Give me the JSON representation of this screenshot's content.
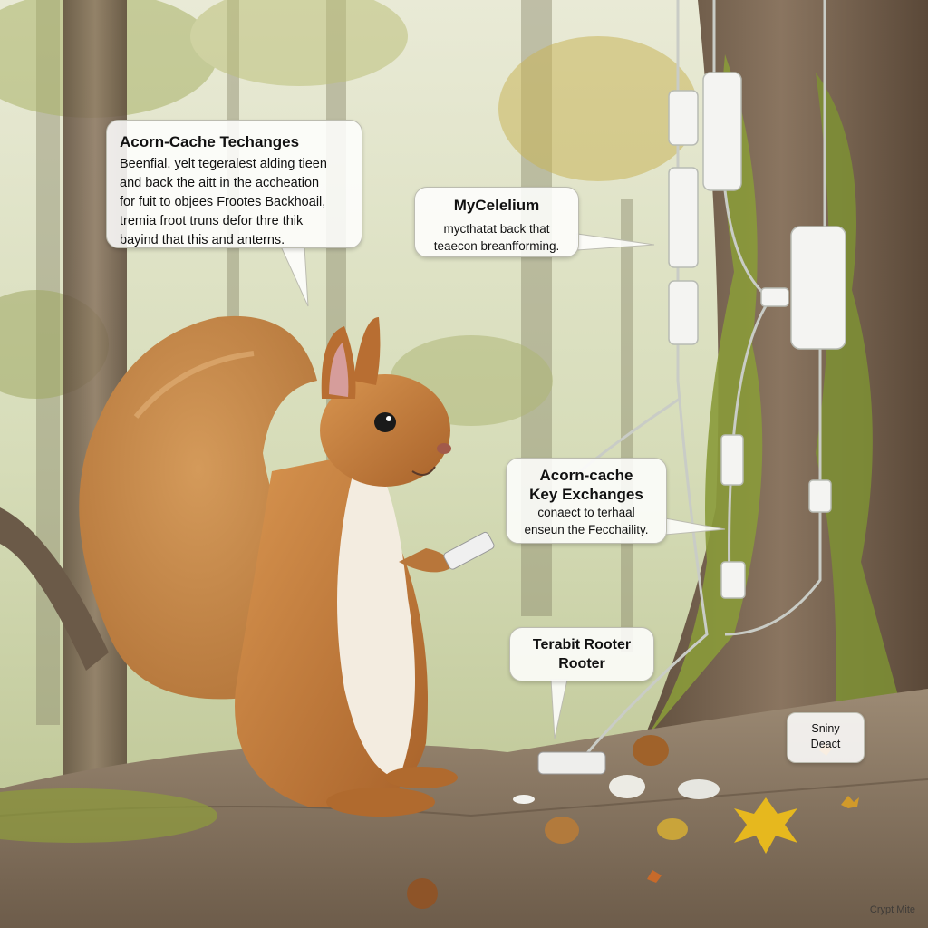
{
  "callouts": {
    "acorn_cache_techanges": {
      "title": "Acorn-Cache Techanges",
      "lines": [
        "Beenfial, yelt tegeralest alding tieen",
        "and back the aitt in the accheation",
        "for fuit to objees Frootes Backhoail,",
        "tremia froot truns defor thre thik",
        "bayind that this and anterns."
      ]
    },
    "mycelium": {
      "title": "MyCelelium",
      "lines": [
        "mycthatat back that",
        "teaecon breanfforming."
      ]
    },
    "acorn_cache_key_exchanges": {
      "title_lines": [
        "Acorn-cache",
        "Key Exchanges"
      ],
      "lines": [
        "conaect to terhaal",
        "enseun the Fecchaility."
      ]
    },
    "terabit_rooter": {
      "title_lines": [
        "Terabit Rooter",
        "Rooter"
      ]
    },
    "sniny_deact": {
      "lines": [
        "Sniny",
        "Deact"
      ]
    }
  },
  "watermark": "Crypt Mite",
  "colors": {
    "forest_mist": "#cfd6b4",
    "squirrel_fur": "#c47a35",
    "moss": "#8a9a3a",
    "bark": "#6e5a46",
    "device_white": "#f4f4f2"
  },
  "icons": [
    "squirrel-figure",
    "phone-icon",
    "router-device-icon",
    "acorn-icon",
    "maple-leaf-icon",
    "cable-icon"
  ]
}
